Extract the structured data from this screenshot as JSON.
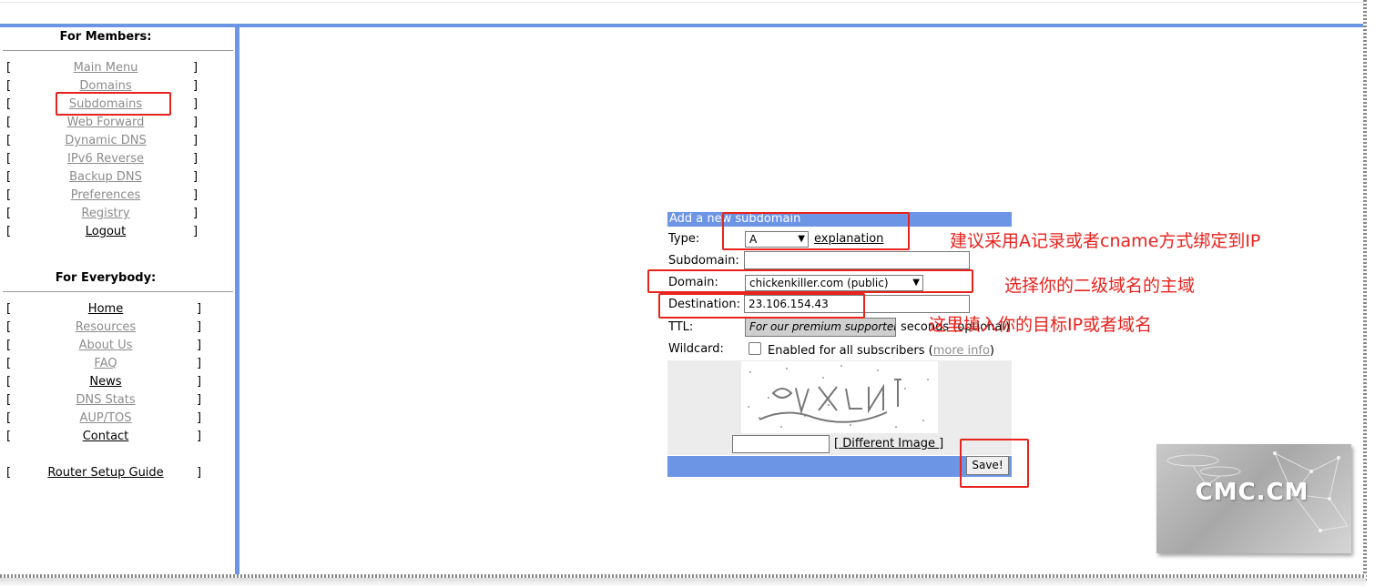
{
  "sidebar": {
    "members_title": "For Members:",
    "everybody_title": "For Everybody:",
    "bracket_open": "[",
    "bracket_close": "]",
    "members_items": [
      {
        "label": "Main Menu"
      },
      {
        "label": "Domains"
      },
      {
        "label": "Subdomains"
      },
      {
        "label": "Web Forward"
      },
      {
        "label": "Dynamic DNS"
      },
      {
        "label": "IPv6 Reverse"
      },
      {
        "label": "Backup DNS"
      },
      {
        "label": "Preferences"
      },
      {
        "label": "Registry"
      },
      {
        "label": "Logout"
      }
    ],
    "everybody_items": [
      {
        "label": "Home"
      },
      {
        "label": "Resources"
      },
      {
        "label": "About Us"
      },
      {
        "label": "FAQ"
      },
      {
        "label": "News"
      },
      {
        "label": "DNS Stats"
      },
      {
        "label": "AUP/TOS"
      },
      {
        "label": "Contact"
      }
    ],
    "router_guide": "Router Setup Guide"
  },
  "form": {
    "title": "Add a new subdomain",
    "type_label": "Type:",
    "type_value": "A",
    "explanation_link": "explanation",
    "subdomain_label": "Subdomain:",
    "subdomain_value": "",
    "domain_label": "Domain:",
    "domain_value": "chickenkiller.com (public)",
    "destination_label": "Destination:",
    "destination_value": "23.106.154.43",
    "ttl_label": "TTL:",
    "ttl_value": "For our premium supporters",
    "ttl_suffix": "seconds (optional)",
    "wildcard_label": "Wildcard:",
    "wildcard_text": "Enabled for all subscribers (",
    "more_info_link": "more info",
    "wildcard_close": ")",
    "captcha_value": "",
    "different_image_link": "[ Different Image ]",
    "save_label": "Save!"
  },
  "annotations": {
    "type_note": "建议采用A记录或者cname方式绑定到IP",
    "domain_note": "选择你的二级域名的主域",
    "destination_note": "这里填入你的目标IP或者域名"
  },
  "watermark": {
    "text": "CMC.CM"
  },
  "colors": {
    "accent": "#6d95e6",
    "annotation": "#e8221d"
  }
}
